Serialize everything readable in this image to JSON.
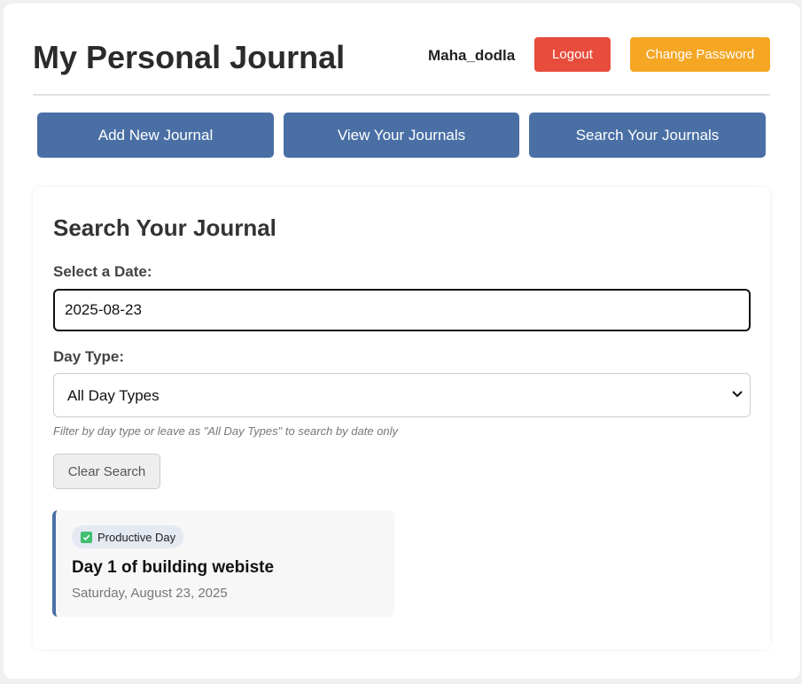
{
  "header": {
    "title": "My Personal Journal",
    "username": "Maha_dodla",
    "logout_label": "Logout",
    "change_password_label": "Change Password"
  },
  "nav": {
    "add_label": "Add New Journal",
    "view_label": "View Your Journals",
    "search_label": "Search Your Journals"
  },
  "search": {
    "title": "Search Your Journal",
    "date_label": "Select a Date:",
    "date_value": "2025-08-23",
    "day_type_label": "Day Type:",
    "day_type_selected": "All Day Types",
    "hint": "Filter by day type or leave as \"All Day Types\" to search by date only",
    "clear_label": "Clear Search"
  },
  "results": [
    {
      "badge_icon": "check-icon",
      "badge": "Productive Day",
      "title": "Day 1 of building webiste",
      "date": "Saturday, August 23, 2025"
    }
  ],
  "colors": {
    "accent": "#4a6fa5",
    "logout": "#e74c3c",
    "change_password": "#f5a623",
    "badge_check": "#3fbf6f"
  }
}
